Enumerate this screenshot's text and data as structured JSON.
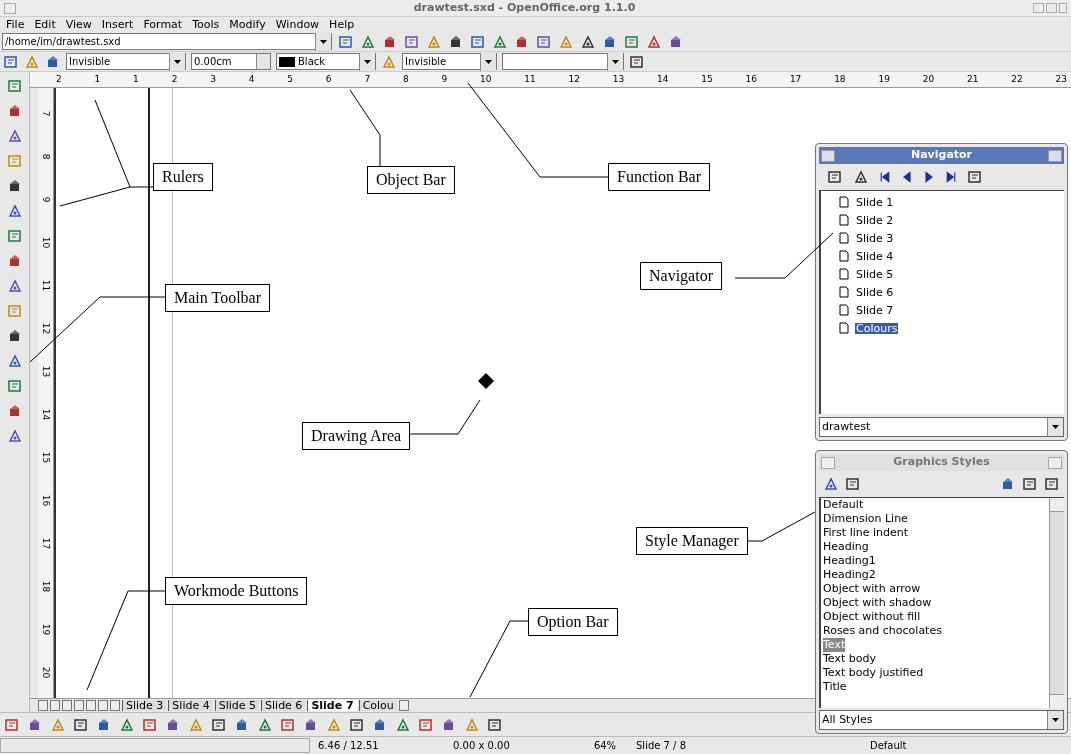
{
  "window": {
    "title": "drawtest.sxd - OpenOffice.org 1.1.0"
  },
  "menu": [
    "File",
    "Edit",
    "View",
    "Insert",
    "Format",
    "Tools",
    "Modify",
    "Window",
    "Help"
  ],
  "function_bar": {
    "url": "/home/im/drawtest.sxd"
  },
  "object_bar": {
    "line_style": "Invisible",
    "line_width": "0.00cm",
    "line_color": "Black",
    "area_style": "Invisible"
  },
  "rulers": {
    "horizontal": [
      "2",
      "1",
      "1",
      "2",
      "3",
      "4",
      "5",
      "6",
      "7",
      "8",
      "9",
      "10",
      "11",
      "12",
      "13",
      "14",
      "15",
      "16",
      "17",
      "18",
      "19",
      "20",
      "21",
      "22",
      "23"
    ],
    "vertical": [
      "7",
      "8",
      "9",
      "10",
      "11",
      "12",
      "13",
      "14",
      "15",
      "16",
      "17",
      "18",
      "19",
      "20"
    ]
  },
  "slide_tabs": [
    {
      "label": "Slide 3",
      "selected": false
    },
    {
      "label": "Slide 4",
      "selected": false
    },
    {
      "label": "Slide 5",
      "selected": false
    },
    {
      "label": "Slide 6",
      "selected": false
    },
    {
      "label": "Slide 7",
      "selected": true
    },
    {
      "label": "Colou",
      "selected": false
    }
  ],
  "navigator": {
    "title": "Navigator",
    "items": [
      {
        "label": "Slide 1",
        "selected": false
      },
      {
        "label": "Slide 2",
        "selected": false
      },
      {
        "label": "Slide 3",
        "selected": false
      },
      {
        "label": "Slide 4",
        "selected": false
      },
      {
        "label": "Slide 5",
        "selected": false
      },
      {
        "label": "Slide 6",
        "selected": false
      },
      {
        "label": "Slide 7",
        "selected": false
      },
      {
        "label": "Colours",
        "selected": true
      }
    ],
    "document": "drawtest"
  },
  "styles": {
    "title": "Graphics Styles",
    "items": [
      {
        "label": "Default",
        "selected": false
      },
      {
        "label": "Dimension Line",
        "selected": false
      },
      {
        "label": "First line indent",
        "selected": false
      },
      {
        "label": "Heading",
        "selected": false
      },
      {
        "label": "Heading1",
        "selected": false
      },
      {
        "label": "Heading2",
        "selected": false
      },
      {
        "label": "Object with arrow",
        "selected": false
      },
      {
        "label": "Object with shadow",
        "selected": false
      },
      {
        "label": "Object without fill",
        "selected": false
      },
      {
        "label": "Roses and chocolates",
        "selected": false
      },
      {
        "label": "Text",
        "selected": true
      },
      {
        "label": "Text body",
        "selected": false
      },
      {
        "label": "Text body justified",
        "selected": false
      },
      {
        "label": "Title",
        "selected": false
      }
    ],
    "filter": "All Styles"
  },
  "status_bar": {
    "position": "6.46 / 12.51",
    "size": "0.00 x 0.00",
    "zoom": "64%",
    "slide": "Slide 7 / 8",
    "style": "Default"
  },
  "callouts": [
    {
      "label": "Rulers"
    },
    {
      "label": "Object Bar"
    },
    {
      "label": "Function Bar"
    },
    {
      "label": "Navigator"
    },
    {
      "label": "Main Toolbar"
    },
    {
      "label": "Drawing Area"
    },
    {
      "label": "Style Manager"
    },
    {
      "label": "Workmode Buttons"
    },
    {
      "label": "Option Bar"
    }
  ]
}
